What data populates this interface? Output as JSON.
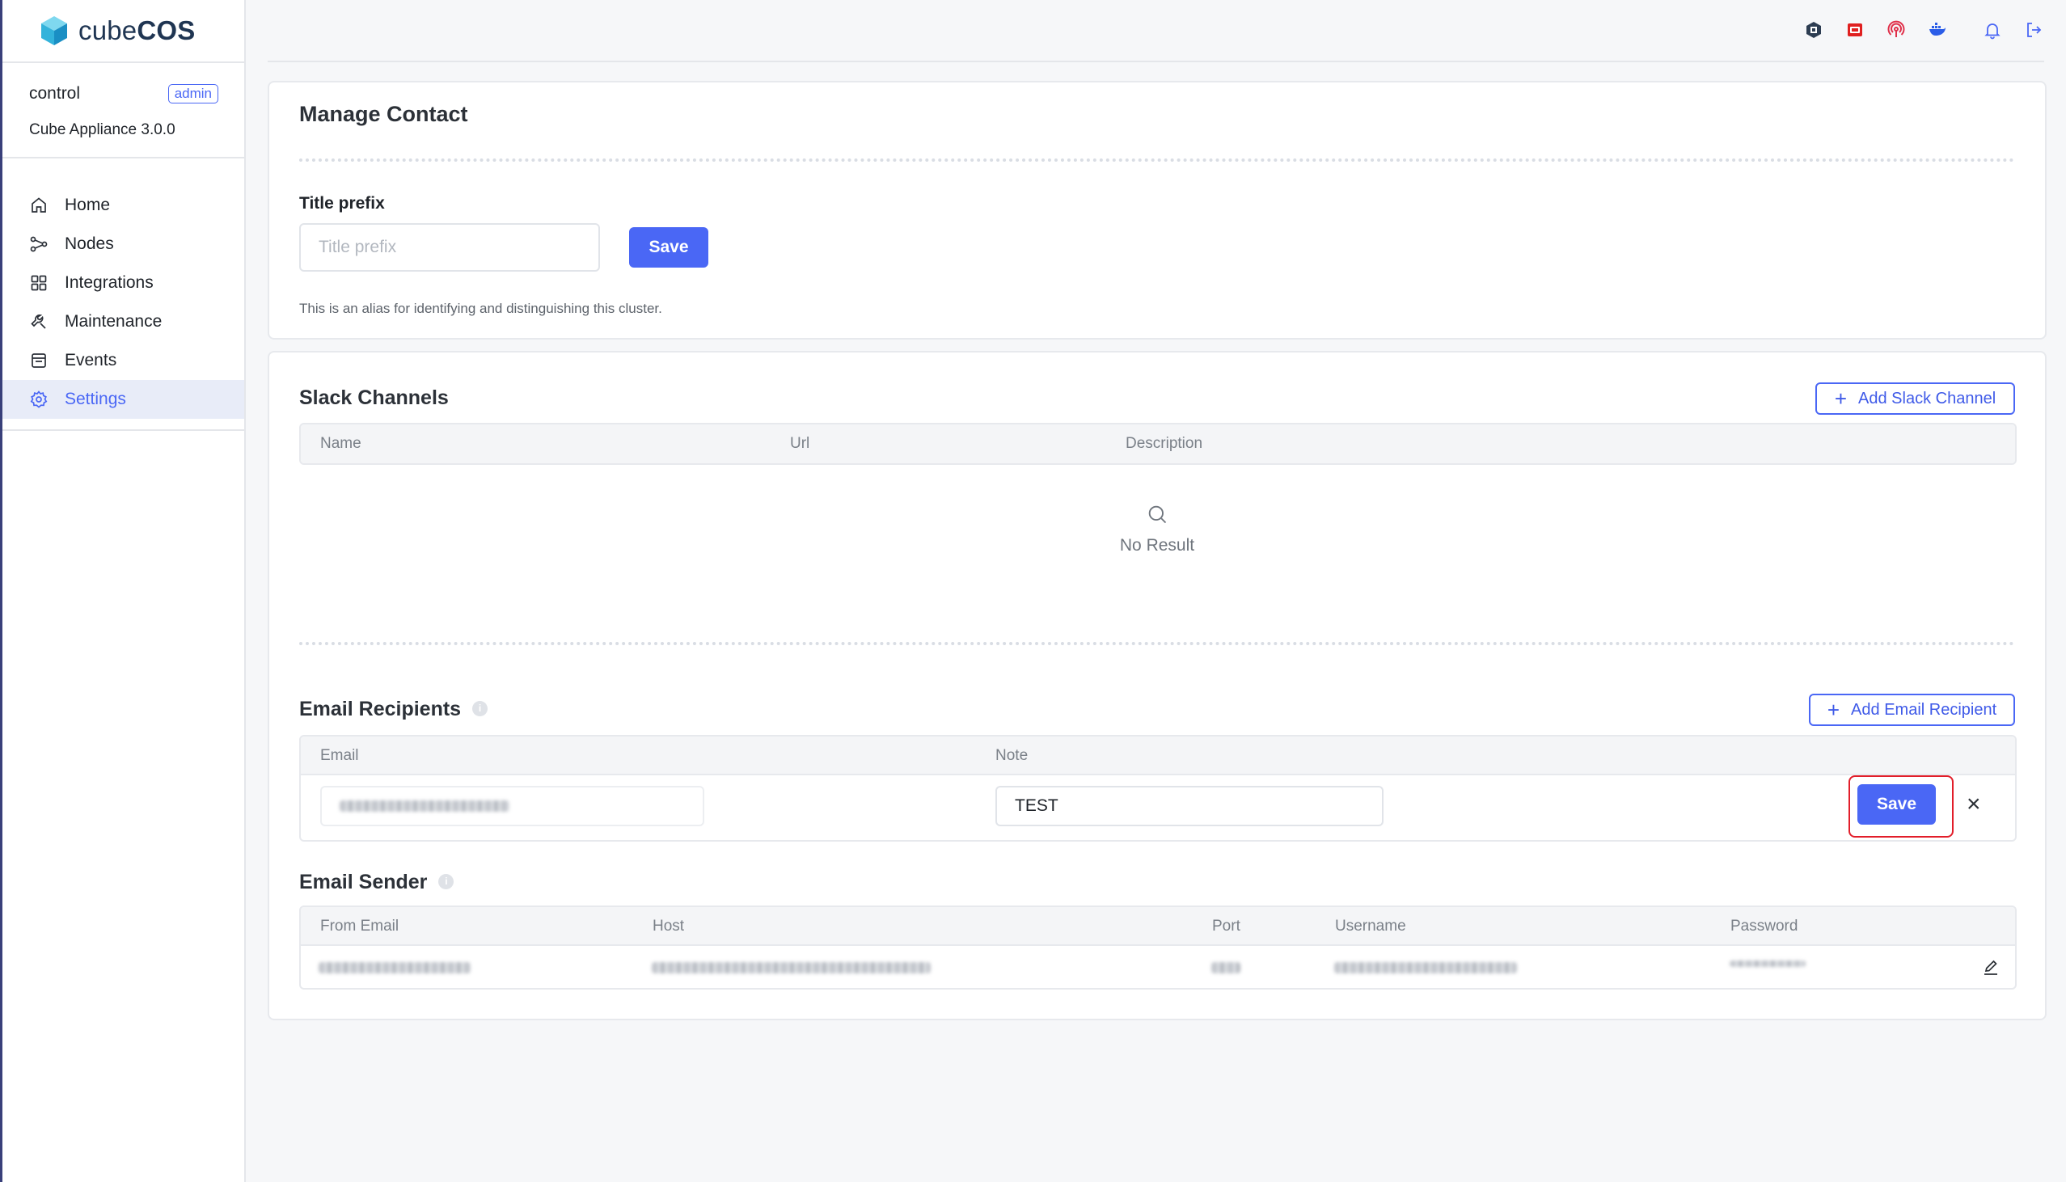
{
  "app": {
    "brand_light": "cube",
    "brand_bold": "COS"
  },
  "account": {
    "user": "control",
    "role": "admin",
    "version": "Cube Appliance 3.0.0"
  },
  "nav": [
    {
      "label": "Home",
      "icon": "home-icon"
    },
    {
      "label": "Nodes",
      "icon": "nodes-icon"
    },
    {
      "label": "Integrations",
      "icon": "integrations-icon"
    },
    {
      "label": "Maintenance",
      "icon": "maintenance-icon"
    },
    {
      "label": "Events",
      "icon": "events-icon"
    },
    {
      "label": "Settings",
      "icon": "gear-icon",
      "active": true
    }
  ],
  "topbar": {
    "icons": [
      "openstack-icon",
      "redhat-icon",
      "podcast-icon",
      "docker-icon",
      "bell-icon",
      "logout-icon"
    ]
  },
  "manage_contact": {
    "title": "Manage Contact",
    "title_prefix_label": "Title prefix",
    "title_prefix_placeholder": "Title prefix",
    "save_label": "Save",
    "hint": "This is an alias for identifying and distinguishing this cluster."
  },
  "slack": {
    "title": "Slack Channels",
    "add_label": "Add Slack Channel",
    "columns": [
      "Name",
      "Url",
      "Description"
    ],
    "empty_text": "No Result"
  },
  "email_recipients": {
    "title": "Email Recipients",
    "add_label": "Add Email Recipient",
    "columns": [
      "Email",
      "Note"
    ],
    "row": {
      "note_value": "TEST",
      "save_label": "Save"
    }
  },
  "email_sender": {
    "title": "Email Sender",
    "columns": [
      "From Email",
      "Host",
      "Port",
      "Username",
      "Password"
    ]
  },
  "colors": {
    "accent": "#4a67f5",
    "highlight": "#e21e2a",
    "sidebar_active_bg": "#e8ecf8"
  }
}
